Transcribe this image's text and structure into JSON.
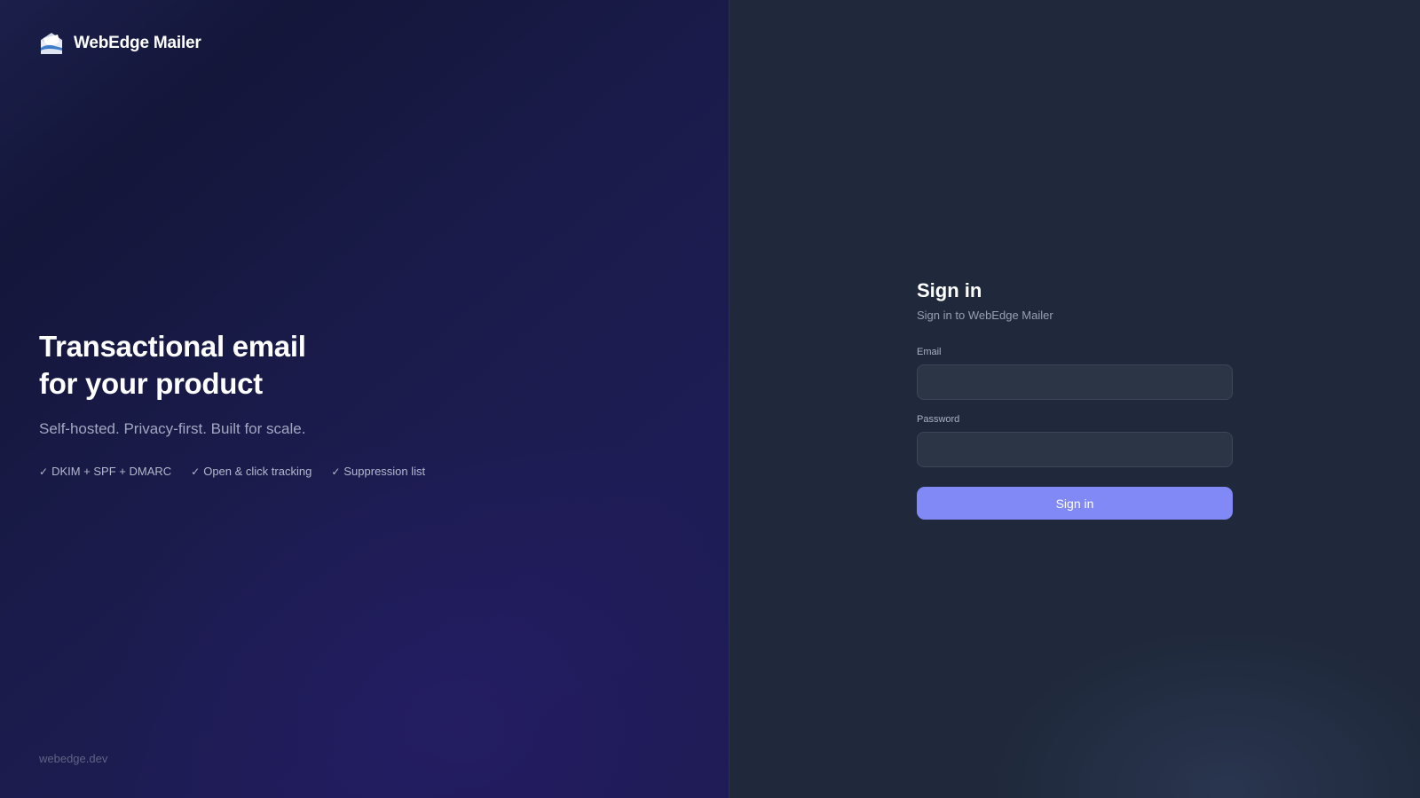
{
  "brand": {
    "name": "WebEdge Mailer",
    "logo_icon": "envelope-open-icon"
  },
  "hero": {
    "title_line1": "Transactional email",
    "title_line2": "for your product",
    "subtitle": "Self-hosted. Privacy-first. Built for scale.",
    "features": [
      {
        "icon": "check-icon",
        "check": "✓",
        "label": "DKIM + SPF + DMARC"
      },
      {
        "icon": "check-icon",
        "check": "✓",
        "label": "Open & click tracking"
      },
      {
        "icon": "check-icon",
        "check": "✓",
        "label": "Suppression list"
      }
    ],
    "footer": "webedge.dev"
  },
  "signin": {
    "title": "Sign in",
    "subtitle": "Sign in to WebEdge Mailer",
    "email_label": "Email",
    "email_value": "",
    "password_label": "Password",
    "password_value": "",
    "submit_label": "Sign in"
  },
  "colors": {
    "accent": "#8089f5",
    "panel": "#1f293b",
    "hero_bg": "#1a1b4a",
    "input_bg": "#2b3545"
  }
}
